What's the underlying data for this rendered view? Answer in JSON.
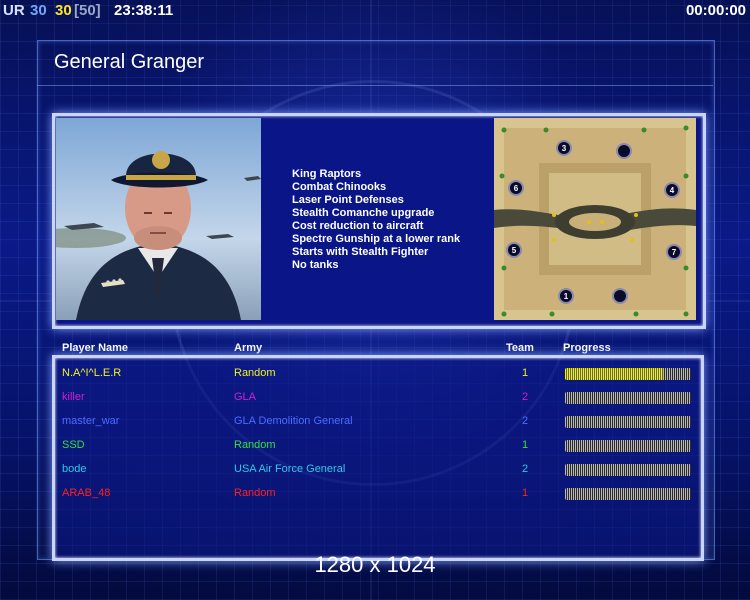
{
  "hud": {
    "ur_label": "UR",
    "value_a": "30",
    "value_b": "30",
    "value_limit": "[50]",
    "clock": "23:38:11",
    "timer": "00:00:00"
  },
  "screen": {
    "general_title": "General Granger",
    "resolution": "1280 x 1024"
  },
  "perks": [
    "King Raptors",
    "Combat Chinooks",
    "Laser Point Defenses",
    "Stealth Comanche upgrade",
    "Cost reduction to aircraft",
    "Spectre Gunship at a lower rank",
    "Starts with Stealth Fighter",
    "No tanks"
  ],
  "map": {
    "start_labels": [
      "3",
      "4",
      "6",
      "5",
      "7",
      "1"
    ]
  },
  "columns": {
    "player": "Player Name",
    "army": "Army",
    "team": "Team",
    "progress": "Progress"
  },
  "players": [
    {
      "name": "N.A^I^L.E.R",
      "army": "Random",
      "team": "1",
      "color": "#f0f020",
      "progress": 0.78
    },
    {
      "name": "killer",
      "army": "GLA",
      "team": "2",
      "color": "#d020d0",
      "progress": 0.0
    },
    {
      "name": "master_war",
      "army": "GLA Demolition General",
      "team": "2",
      "color": "#4b6cff",
      "progress": 0.0
    },
    {
      "name": "SSD",
      "army": "Random",
      "team": "1",
      "color": "#30e040",
      "progress": 0.0
    },
    {
      "name": "bode",
      "army": "USA Air Force General",
      "team": "2",
      "color": "#30c8e8",
      "progress": 0.0
    },
    {
      "name": "ARAB_48",
      "army": "Random",
      "team": "1",
      "color": "#ff2020",
      "progress": 0.0
    }
  ]
}
